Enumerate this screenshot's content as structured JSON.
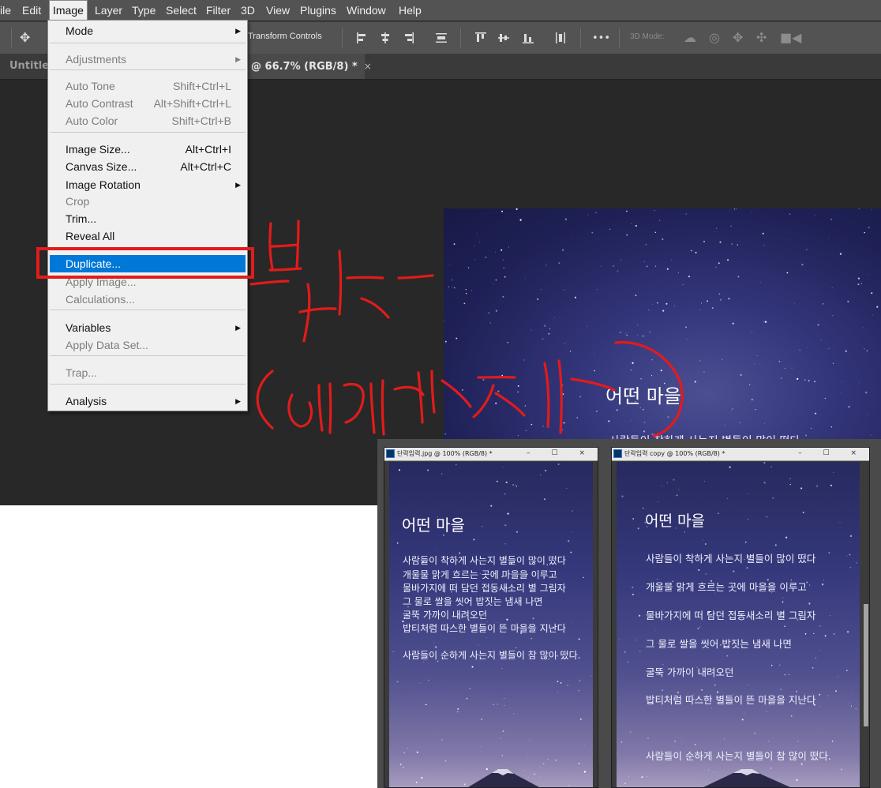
{
  "menubar": {
    "items": [
      "ile",
      "Edit",
      "Image",
      "Layer",
      "Type",
      "Select",
      "Filter",
      "3D",
      "View",
      "Plugins",
      "Window",
      "Help"
    ]
  },
  "options_bar": {
    "transform_label": "Transform Controls",
    "more_label": "•••",
    "mode3d_label": "3D Mode:"
  },
  "tabs": {
    "untitled_label": "Untitled",
    "active_label": "@ 66.7% (RGB/8) *",
    "close_glyph": "×"
  },
  "image_menu": {
    "items": [
      {
        "label": "Mode",
        "shortcut": "",
        "submenu": true,
        "disabled": false
      },
      {
        "label": "Adjustments",
        "shortcut": "",
        "submenu": true,
        "disabled": true
      },
      {
        "label": "Auto Tone",
        "shortcut": "Shift+Ctrl+L",
        "submenu": false,
        "disabled": true
      },
      {
        "label": "Auto Contrast",
        "shortcut": "Alt+Shift+Ctrl+L",
        "submenu": false,
        "disabled": true
      },
      {
        "label": "Auto Color",
        "shortcut": "Shift+Ctrl+B",
        "submenu": false,
        "disabled": true
      },
      {
        "label": "Image Size...",
        "shortcut": "Alt+Ctrl+I",
        "submenu": false,
        "disabled": false
      },
      {
        "label": "Canvas Size...",
        "shortcut": "Alt+Ctrl+C",
        "submenu": false,
        "disabled": false
      },
      {
        "label": "Image Rotation",
        "shortcut": "",
        "submenu": true,
        "disabled": false
      },
      {
        "label": "Crop",
        "shortcut": "",
        "submenu": false,
        "disabled": true
      },
      {
        "label": "Trim...",
        "shortcut": "",
        "submenu": false,
        "disabled": false
      },
      {
        "label": "Reveal All",
        "shortcut": "",
        "submenu": false,
        "disabled": false
      },
      {
        "label": "Duplicate...",
        "shortcut": "",
        "submenu": false,
        "disabled": false,
        "selected": true
      },
      {
        "label": "Apply Image...",
        "shortcut": "",
        "submenu": false,
        "disabled": true
      },
      {
        "label": "Calculations...",
        "shortcut": "",
        "submenu": false,
        "disabled": true
      },
      {
        "label": "Variables",
        "shortcut": "",
        "submenu": true,
        "disabled": false
      },
      {
        "label": "Apply Data Set...",
        "shortcut": "",
        "submenu": false,
        "disabled": true
      },
      {
        "label": "Trap...",
        "shortcut": "",
        "submenu": false,
        "disabled": true
      },
      {
        "label": "Analysis",
        "shortcut": "",
        "submenu": true,
        "disabled": false
      }
    ],
    "submenu_arrow": "▶"
  },
  "canvas": {
    "title": "어떤 마을",
    "first_line": "사람들이 착하게 사는지 별들이 많이 떴다"
  },
  "doc_left": {
    "title": "단락입력.jpg @ 100% (RGB/8) *",
    "heading": "어떤 마을",
    "lines": [
      "사람들이 착하게 사는지 별들이 많이 떴다",
      "개울물 맑게 흐르는 곳에 마을을 이루고",
      "물바가지에 떠 담던 접동새소리 별 그림자",
      "그 물로 쌀을 씻어 밥짓는 냄새 나면",
      "굴뚝 가까이 내려오던",
      "밥티처럼 따스한 별들이 뜬 마을을 지난다",
      "사람들이 순하게 사는지 별들이 참 많이 떴다."
    ]
  },
  "doc_right": {
    "title": "단락입력 copy @ 100% (RGB/8) *",
    "heading": "어떤 마을",
    "lines": [
      "사람들이 착하게 사는지 별들이 많이 떴다",
      "개울물 맑게 흐르는 곳에 마을을 이루고",
      "물바가지에 떠 담던 접동새소리 별 그림자",
      "그 물로 쌀을 씻어 밥짓는 냄새 나면",
      "굴뚝 가까이 내려오던",
      "밥티처럼 따스한 별들이 뜬 마을을 지난다",
      "사람들이 순하게 사는지 별들이 참 많이 떴다."
    ]
  },
  "doc_window_controls": "– ☐ ×",
  "colors": {
    "menu_selected": "#0078d7",
    "annotation_red": "#e21b1b",
    "ps_dark": "#282828",
    "ps_panel": "#535353"
  }
}
